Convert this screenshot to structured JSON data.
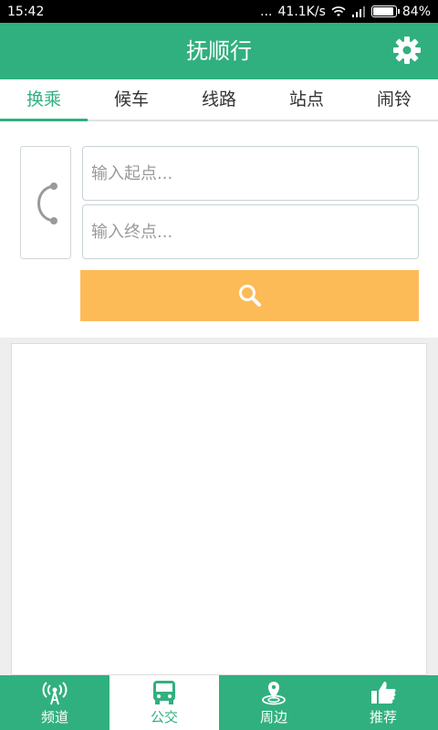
{
  "status_bar": {
    "time": "15:42",
    "network_speed": "41.1K/s",
    "battery": "84%",
    "dots": "..."
  },
  "header": {
    "title": "抚顺行",
    "settings_icon": "gear-icon"
  },
  "tabs": [
    {
      "label": "换乘",
      "active": true
    },
    {
      "label": "候车",
      "active": false
    },
    {
      "label": "线路",
      "active": false
    },
    {
      "label": "站点",
      "active": false
    },
    {
      "label": "闹铃",
      "active": false
    }
  ],
  "route_form": {
    "start_placeholder": "输入起点...",
    "end_placeholder": "输入终点...",
    "swap_icon": "swap-route-icon",
    "search_icon": "search-icon"
  },
  "colors": {
    "primary": "#31b07f",
    "search_button": "#fdbb57"
  },
  "bottom_nav": [
    {
      "label": "频道",
      "icon": "antenna-icon",
      "active": false
    },
    {
      "label": "公交",
      "icon": "bus-icon",
      "active": true
    },
    {
      "label": "周边",
      "icon": "location-pin-icon",
      "active": false
    },
    {
      "label": "推荐",
      "icon": "thumbs-up-icon",
      "active": false
    }
  ]
}
